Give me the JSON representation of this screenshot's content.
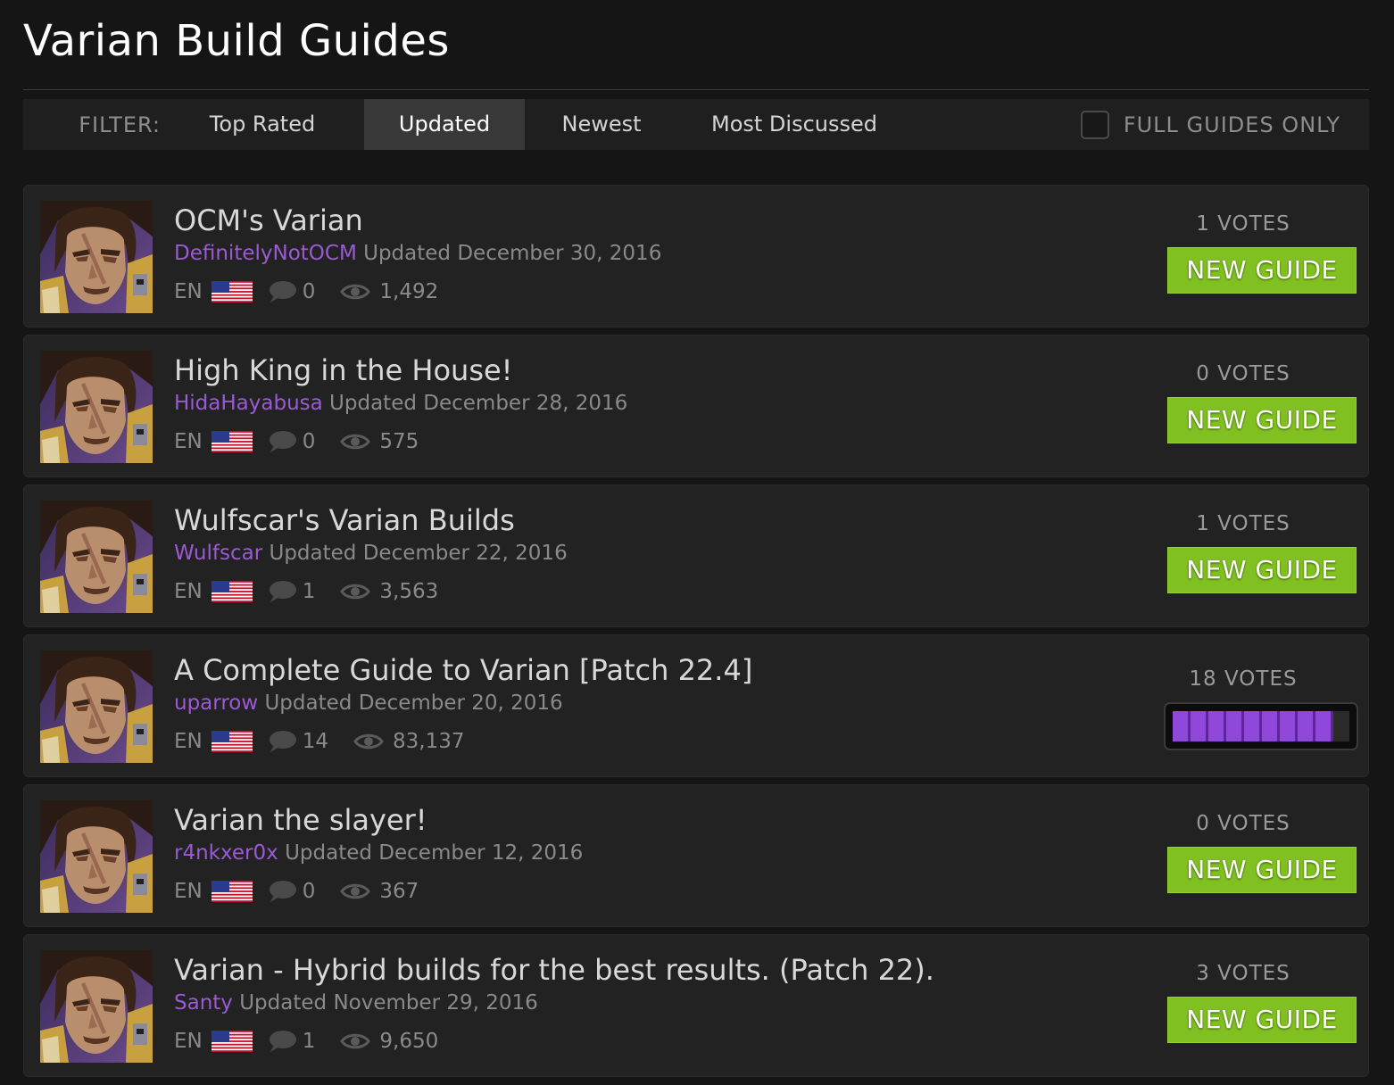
{
  "page": {
    "title": "Varian Build Guides"
  },
  "filter": {
    "label": "FILTER:",
    "tabs": [
      {
        "label": "Top Rated",
        "active": false
      },
      {
        "label": "Updated",
        "active": true
      },
      {
        "label": "Newest",
        "active": false
      },
      {
        "label": "Most Discussed",
        "active": false
      }
    ],
    "full_guides_label": "FULL GUIDES ONLY",
    "full_guides_checked": false
  },
  "colors": {
    "accent_purple": "#9b59d6",
    "button_green": "#80c020",
    "background": "#151515",
    "card": "#222222"
  },
  "guides": [
    {
      "title": "OCM's Varian",
      "author": "DefinitelyNotOCM",
      "updated_label": "Updated",
      "date": "December 30, 2016",
      "lang": "EN",
      "comments": "0",
      "views": "1,492",
      "votes": "1 VOTES",
      "badge": "NEW GUIDE"
    },
    {
      "title": "High King in the House!",
      "author": "HidaHayabusa",
      "updated_label": "Updated",
      "date": "December 28, 2016",
      "lang": "EN",
      "comments": "0",
      "views": "575",
      "votes": "0 VOTES",
      "badge": "NEW GUIDE"
    },
    {
      "title": "Wulfscar's Varian Builds",
      "author": "Wulfscar",
      "updated_label": "Updated",
      "date": "December 22, 2016",
      "lang": "EN",
      "comments": "1",
      "views": "3,563",
      "votes": "1 VOTES",
      "badge": "NEW GUIDE"
    },
    {
      "title": "A Complete Guide to Varian [Patch 22.4]",
      "author": "uparrow",
      "updated_label": "Updated",
      "date": "December 20, 2016",
      "lang": "EN",
      "comments": "14",
      "views": "83,137",
      "votes": "18 VOTES",
      "rating_fraction": 0.91
    },
    {
      "title": "Varian the slayer!",
      "author": "r4nkxer0x",
      "updated_label": "Updated",
      "date": "December 12, 2016",
      "lang": "EN",
      "comments": "0",
      "views": "367",
      "votes": "0 VOTES",
      "badge": "NEW GUIDE"
    },
    {
      "title": "Varian - Hybrid builds for the best results. (Patch 22).",
      "author": "Santy",
      "updated_label": "Updated",
      "date": "November 29, 2016",
      "lang": "EN",
      "comments": "1",
      "views": "9,650",
      "votes": "3 VOTES",
      "badge": "NEW GUIDE"
    }
  ],
  "icons": {
    "flag": "us-flag-icon",
    "comments": "comment-bubble-icon",
    "views": "eye-icon",
    "avatar": "varian-portrait"
  }
}
